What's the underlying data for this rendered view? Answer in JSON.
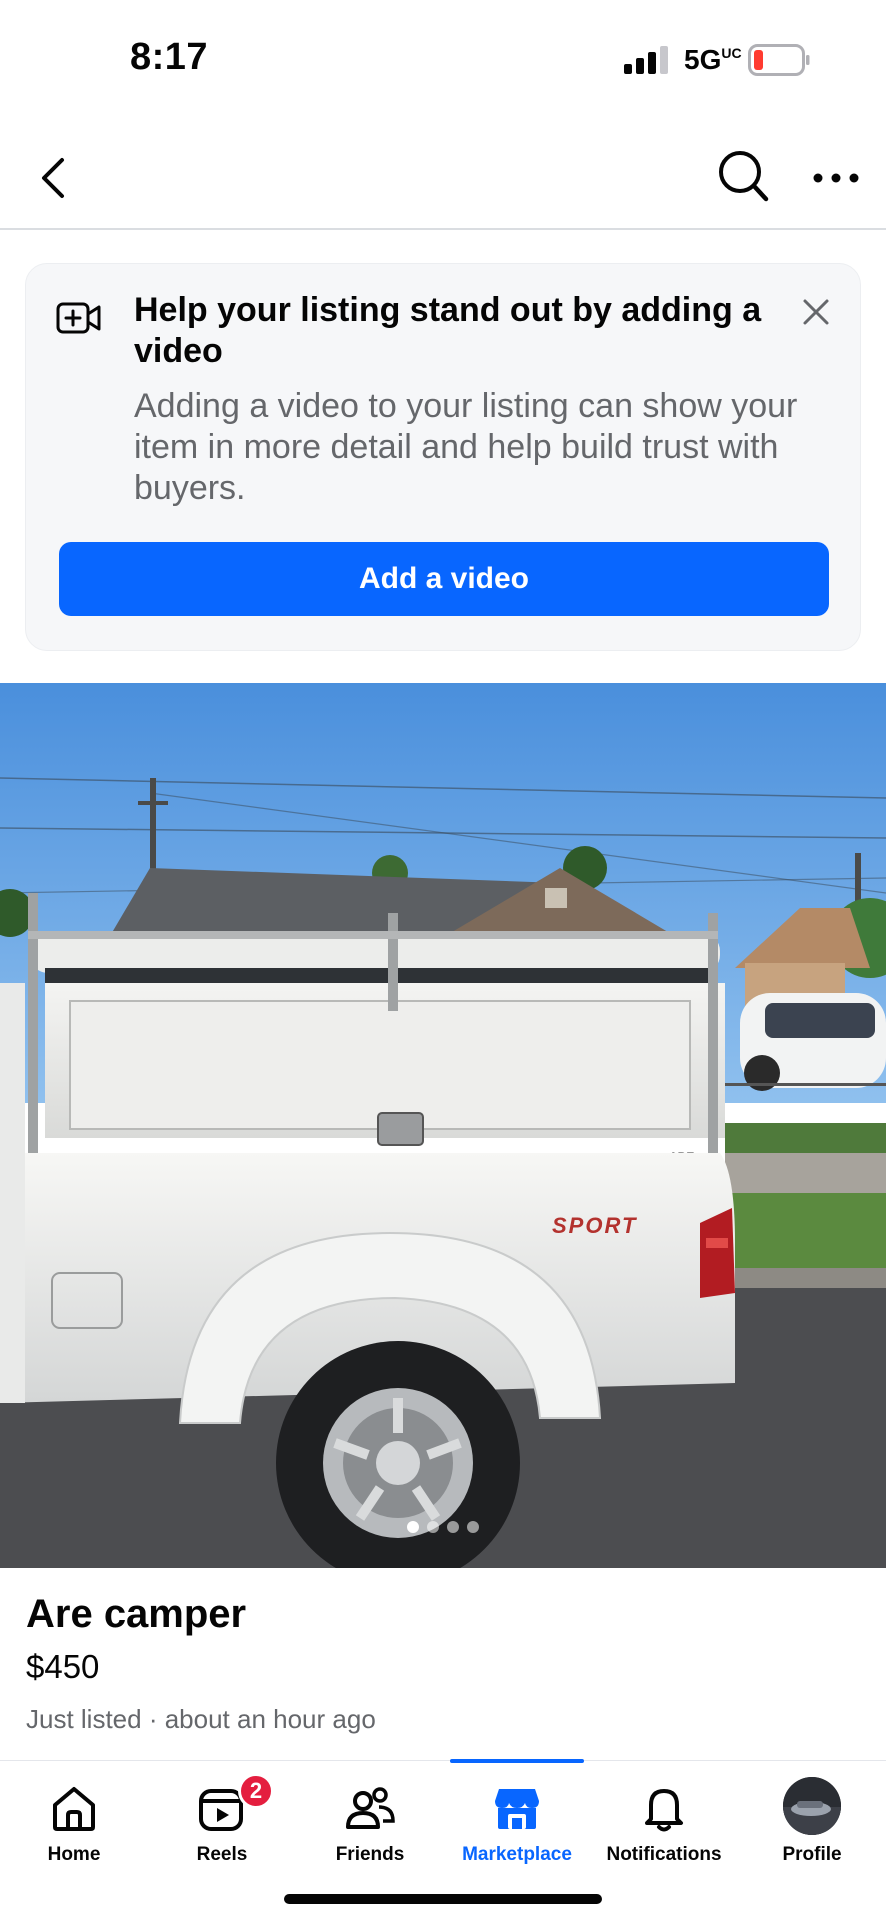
{
  "status_bar": {
    "time": "8:17",
    "network": "5G",
    "network_suffix": "UC",
    "battery_color": "#ff3b30"
  },
  "top_nav": {
    "back_icon": "chevron-left-icon",
    "search_icon": "search-icon",
    "more_icon": "more-horizontal-icon"
  },
  "promo": {
    "icon": "video-add-icon",
    "title": "Help your listing stand out by adding a video",
    "body": "Adding a video to your listing can show your item in more detail and help build trust with buyers.",
    "button_label": "Add a video",
    "button_color": "#0866ff",
    "close_icon": "close-icon"
  },
  "photo": {
    "carousel_count": 4,
    "carousel_active": 0,
    "badge_text": "SPORT",
    "brand_text": "ARE"
  },
  "listing": {
    "title": "Are camper",
    "price": "$450",
    "meta": "Just listed · about an hour ago"
  },
  "tab_bar": {
    "active_color": "#0866ff",
    "tabs": [
      {
        "label": "Home",
        "icon": "home-icon"
      },
      {
        "label": "Reels",
        "icon": "reels-icon",
        "badge": "2"
      },
      {
        "label": "Friends",
        "icon": "friends-icon"
      },
      {
        "label": "Marketplace",
        "icon": "marketplace-icon",
        "active": true
      },
      {
        "label": "Notifications",
        "icon": "bell-icon"
      },
      {
        "label": "Profile",
        "icon": "avatar"
      }
    ]
  }
}
